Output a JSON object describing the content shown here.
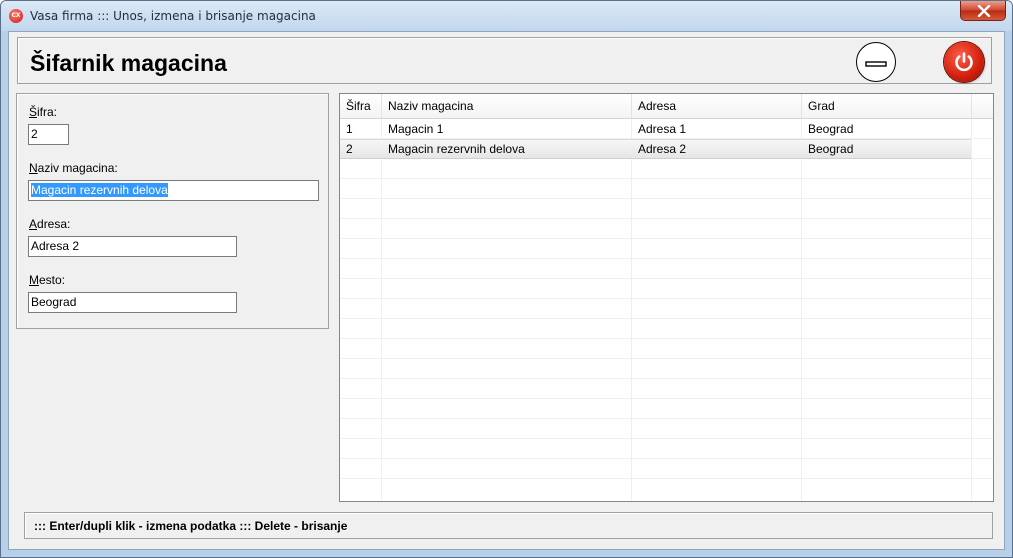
{
  "window": {
    "app_icon_text": "CX",
    "title": "Vasa firma ::: Unos, izmena i brisanje magacina"
  },
  "header": {
    "title": "Šifarnik magacina"
  },
  "form": {
    "sifra": {
      "label_key": "Š",
      "label_rest": "ifra:",
      "value": "2"
    },
    "naziv": {
      "label_key": "N",
      "label_rest": "aziv magacina:",
      "value": "Magacin rezervnih delova"
    },
    "adresa": {
      "label_key": "A",
      "label_rest": "dresa:",
      "value": "Adresa 2"
    },
    "mesto": {
      "label_key": "M",
      "label_rest": "esto:",
      "value": "Beograd"
    }
  },
  "table": {
    "columns": [
      "Šifra",
      "Naziv magacina",
      "Adresa",
      "Grad"
    ],
    "rows": [
      {
        "sifra": "1",
        "naziv": "Magacin 1",
        "adresa": "Adresa 1",
        "grad": "Beograd"
      },
      {
        "sifra": "2",
        "naziv": "Magacin rezervnih delova",
        "adresa": "Adresa 2",
        "grad": "Beograd"
      }
    ],
    "selected_row": 2
  },
  "status": {
    "text": "::: Enter/dupli klik - izmena podatka ::: Delete - brisanje"
  },
  "icons": {
    "minimize": "minimize-icon",
    "power": "power-icon",
    "close": "close-icon"
  },
  "colors": {
    "power_button": "#d01f0c",
    "selection_highlight": "#3399ff",
    "close_button": "#c9381f"
  }
}
